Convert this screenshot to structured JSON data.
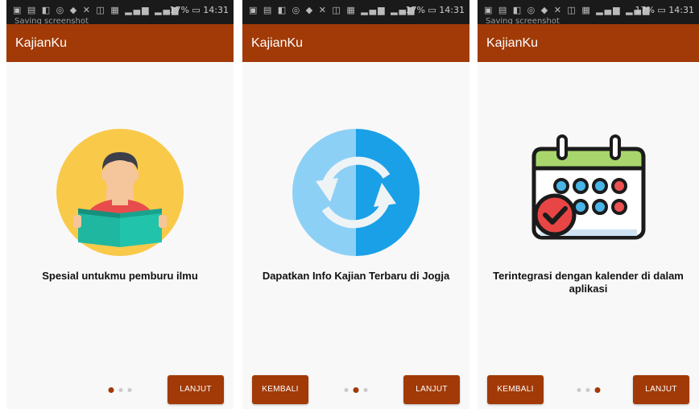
{
  "status_bar": {
    "time": "14:31",
    "battery": "17%",
    "notification": "Saving screenshot"
  },
  "app": {
    "title": "KajianKu",
    "accent_color": "#a13a07"
  },
  "screens": [
    {
      "illustration": "reading-person-icon",
      "caption": "Spesial untukmu pemburu ilmu",
      "back_label": "",
      "next_label": "LANJUT",
      "page_index": 0
    },
    {
      "illustration": "refresh-sync-icon",
      "caption": "Dapatkan Info Kajian Terbaru di Jogja",
      "back_label": "KEMBALI",
      "next_label": "LANJUT",
      "page_index": 1
    },
    {
      "illustration": "calendar-check-icon",
      "caption": "Terintegrasi dengan kalender di dalam aplikasi",
      "back_label": "KEMBALI",
      "next_label": "LANJUT",
      "page_index": 2
    }
  ],
  "page_count": 3
}
